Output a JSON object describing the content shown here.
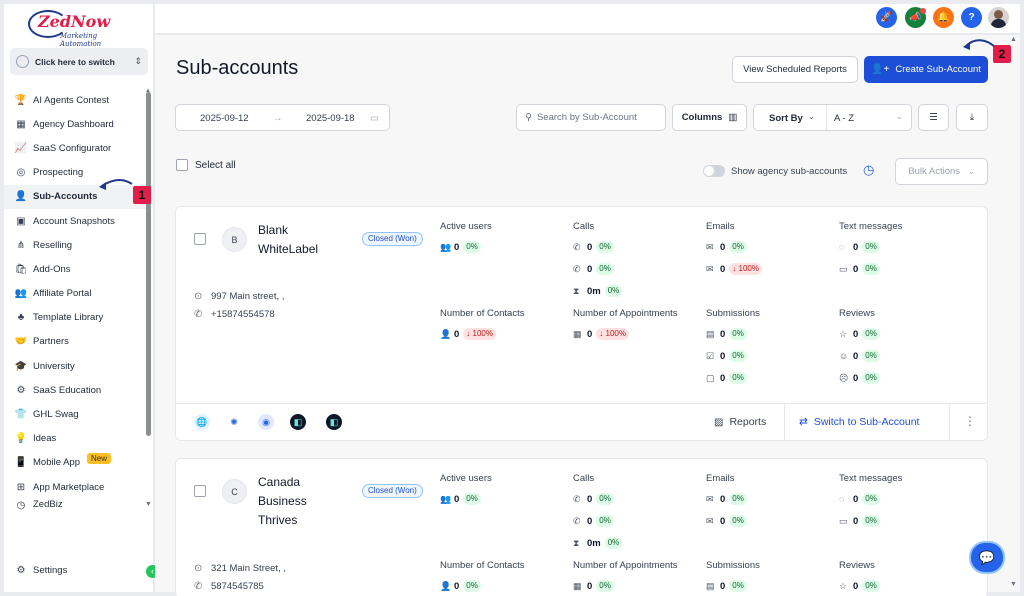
{
  "brand": {
    "name": "ZedNow",
    "tagline": "Marketing Automation"
  },
  "switcher": {
    "label": "Click here to switch"
  },
  "sidebar": {
    "items": [
      {
        "label": "AI Agents Contest",
        "icon": "trophy-icon",
        "glyph": "🏆"
      },
      {
        "label": "Agency Dashboard",
        "icon": "dashboard-icon",
        "glyph": "▦"
      },
      {
        "label": "SaaS Configurator",
        "icon": "chart-icon",
        "glyph": "📈"
      },
      {
        "label": "Prospecting",
        "icon": "globe-icon",
        "glyph": "◎"
      },
      {
        "label": "Sub-Accounts",
        "icon": "user-icon",
        "glyph": "👤"
      },
      {
        "label": "Account Snapshots",
        "icon": "snapshot-icon",
        "glyph": "▣"
      },
      {
        "label": "Reselling",
        "icon": "network-icon",
        "glyph": "⋔"
      },
      {
        "label": "Add-Ons",
        "icon": "bag-icon",
        "glyph": "🛍"
      },
      {
        "label": "Affiliate Portal",
        "icon": "users-icon",
        "glyph": "👥"
      },
      {
        "label": "Template Library",
        "icon": "library-icon",
        "glyph": "♣"
      },
      {
        "label": "Partners",
        "icon": "handshake-icon",
        "glyph": "🤝"
      },
      {
        "label": "University",
        "icon": "graduation-cap-icon",
        "glyph": "🎓"
      },
      {
        "label": "SaaS Education",
        "icon": "puzzle-icon",
        "glyph": "⚙"
      },
      {
        "label": "GHL Swag",
        "icon": "shirt-icon",
        "glyph": "👕"
      },
      {
        "label": "Ideas",
        "icon": "lightbulb-icon",
        "glyph": "💡"
      },
      {
        "label": "Mobile App",
        "icon": "phone-icon",
        "glyph": "📱",
        "badge": "New"
      },
      {
        "label": "App Marketplace",
        "icon": "apps-grid-icon",
        "glyph": "⊞"
      },
      {
        "label": "ZedBiz",
        "icon": "zedbiz-icon",
        "glyph": "◷"
      }
    ],
    "active_index": 4,
    "settings_label": "Settings"
  },
  "topbar": {
    "icons": [
      {
        "name": "rocket-icon",
        "glyph": "🚀",
        "color": "#2563eb"
      },
      {
        "name": "megaphone-icon",
        "glyph": "📣",
        "color": "#15803d"
      },
      {
        "name": "bell-icon",
        "glyph": "🔔",
        "color": "#f97316"
      },
      {
        "name": "help-icon",
        "glyph": "?",
        "color": "#2563eb"
      }
    ]
  },
  "page": {
    "title": "Sub-accounts",
    "view_reports_label": "View Scheduled Reports",
    "create_label": "Create Sub-Account",
    "date_start": "2025-09-12",
    "date_end": "2025-09-18",
    "search_placeholder": "Search by Sub-Account",
    "columns_label": "Columns",
    "sort_by_label": "Sort By",
    "sort_value": "A - Z",
    "select_all_label": "Select all",
    "show_agency_label": "Show agency sub-accounts",
    "bulk_actions_label": "Bulk Actions"
  },
  "metric_labels": {
    "active_users": "Active users",
    "calls": "Calls",
    "emails": "Emails",
    "texts": "Text messages",
    "contacts": "Number of Contacts",
    "appointments": "Number of Appointments",
    "submissions": "Submissions",
    "reviews": "Reviews"
  },
  "cards": [
    {
      "initial": "B",
      "name": "Blank WhiteLabel",
      "status": "Closed (Won)",
      "address": "997 Main street, ,",
      "phone": "+15874554578",
      "active_users": {
        "value": "0",
        "pct": "0%"
      },
      "calls": [
        {
          "value": "0",
          "pct": "0%"
        },
        {
          "value": "0",
          "pct": "0%"
        },
        {
          "value": "0m",
          "pct": "0%"
        }
      ],
      "emails": [
        {
          "value": "0",
          "pct": "0%"
        },
        {
          "value": "0",
          "pct": "↓ 100%"
        }
      ],
      "texts": [
        {
          "value": "0",
          "pct": "0%"
        },
        {
          "value": "0",
          "pct": "0%"
        }
      ],
      "contacts": {
        "value": "0",
        "pct": "↓ 100%"
      },
      "appointments": {
        "value": "0",
        "pct": "↓ 100%"
      },
      "submissions": [
        {
          "value": "0",
          "pct": "0%"
        },
        {
          "value": "0",
          "pct": "0%"
        },
        {
          "value": "0",
          "pct": "0%"
        }
      ],
      "reviews": [
        {
          "value": "0",
          "pct": "0%"
        },
        {
          "value": "0",
          "pct": "0%"
        },
        {
          "value": "0",
          "pct": "0%"
        }
      ],
      "reports_label": "Reports",
      "switch_label": "Switch to Sub-Account"
    },
    {
      "initial": "C",
      "name": "Canada Business Thrives",
      "status": "Closed (Won)",
      "address": "321 Main Street, ,",
      "phone": "5874545785",
      "active_users": {
        "value": "0",
        "pct": "0%"
      },
      "calls": [
        {
          "value": "0",
          "pct": "0%"
        },
        {
          "value": "0",
          "pct": "0%"
        },
        {
          "value": "0m",
          "pct": "0%"
        }
      ],
      "emails": [
        {
          "value": "0",
          "pct": "0%"
        },
        {
          "value": "0",
          "pct": "0%"
        }
      ],
      "texts": [
        {
          "value": "0",
          "pct": "0%"
        },
        {
          "value": "0",
          "pct": "0%"
        }
      ],
      "contacts": {
        "value": "0",
        "pct": "0%"
      },
      "appointments": {
        "value": "0",
        "pct": "0%"
      },
      "submissions": [
        {
          "value": "0",
          "pct": "0%"
        }
      ],
      "reviews": [
        {
          "value": "0",
          "pct": "0%"
        }
      ]
    }
  ],
  "annotations": {
    "step1": "1",
    "step2": "2"
  }
}
